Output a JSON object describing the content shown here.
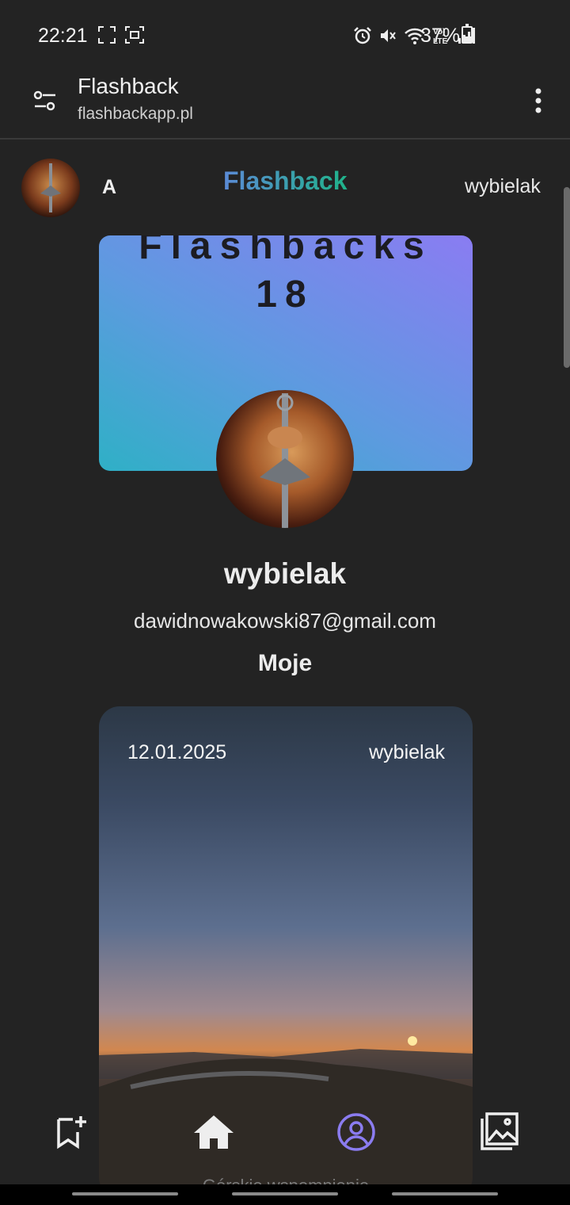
{
  "status_bar": {
    "time": "22:21",
    "battery": "37%",
    "battery_level": 0.37,
    "icons": [
      "fullscreen-icon",
      "screenshot-icon",
      "alarm-icon",
      "mute-icon",
      "wifi-icon",
      "volte-icon",
      "signal-icon",
      "battery-icon"
    ]
  },
  "browser": {
    "title": "Flashback",
    "url": "flashbackapp.pl",
    "icons": {
      "left": "tune-icon",
      "right": "more-vertical-icon"
    }
  },
  "header": {
    "letter": "A",
    "brand": "Flashback",
    "username": "wybielak"
  },
  "banner": {
    "title": "Flashbacks",
    "count": "18"
  },
  "profile": {
    "name": "wybielak",
    "email": "dawidnowakowski87@gmail.com",
    "section": "Moje"
  },
  "card": {
    "date": "12.01.2025",
    "user": "wybielak",
    "caption": "Górskie wspomnienie"
  },
  "bottom_nav": {
    "items": [
      "bookmark-add-icon",
      "home-icon",
      "profile-icon",
      "gallery-icon"
    ],
    "active": "profile-icon",
    "active_color": "#8b7cf0"
  }
}
